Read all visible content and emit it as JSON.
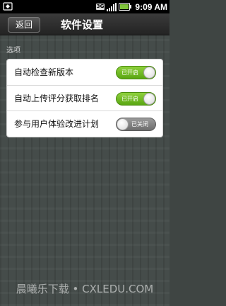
{
  "status_bar": {
    "network_badge": "3G",
    "time": "9:09 AM",
    "icons": [
      "notification-icon",
      "signal-icon",
      "battery-icon"
    ]
  },
  "title_bar": {
    "back_label": "返回",
    "title": "软件设置"
  },
  "section": {
    "label": "选项"
  },
  "settings": [
    {
      "label": "自动检查新版本",
      "state_label": "已开启",
      "enabled": true
    },
    {
      "label": "自动上传评分获取排名",
      "state_label": "已开启",
      "enabled": true
    },
    {
      "label": "参与用户体验改进计划",
      "state_label": "已关闭",
      "enabled": false
    }
  ],
  "watermark": "晨曦乐下载 • CXLEDU.COM",
  "colors": {
    "toggle_on": "#6bb81f",
    "toggle_off": "#7d7d7d",
    "background": "#454c4a"
  }
}
